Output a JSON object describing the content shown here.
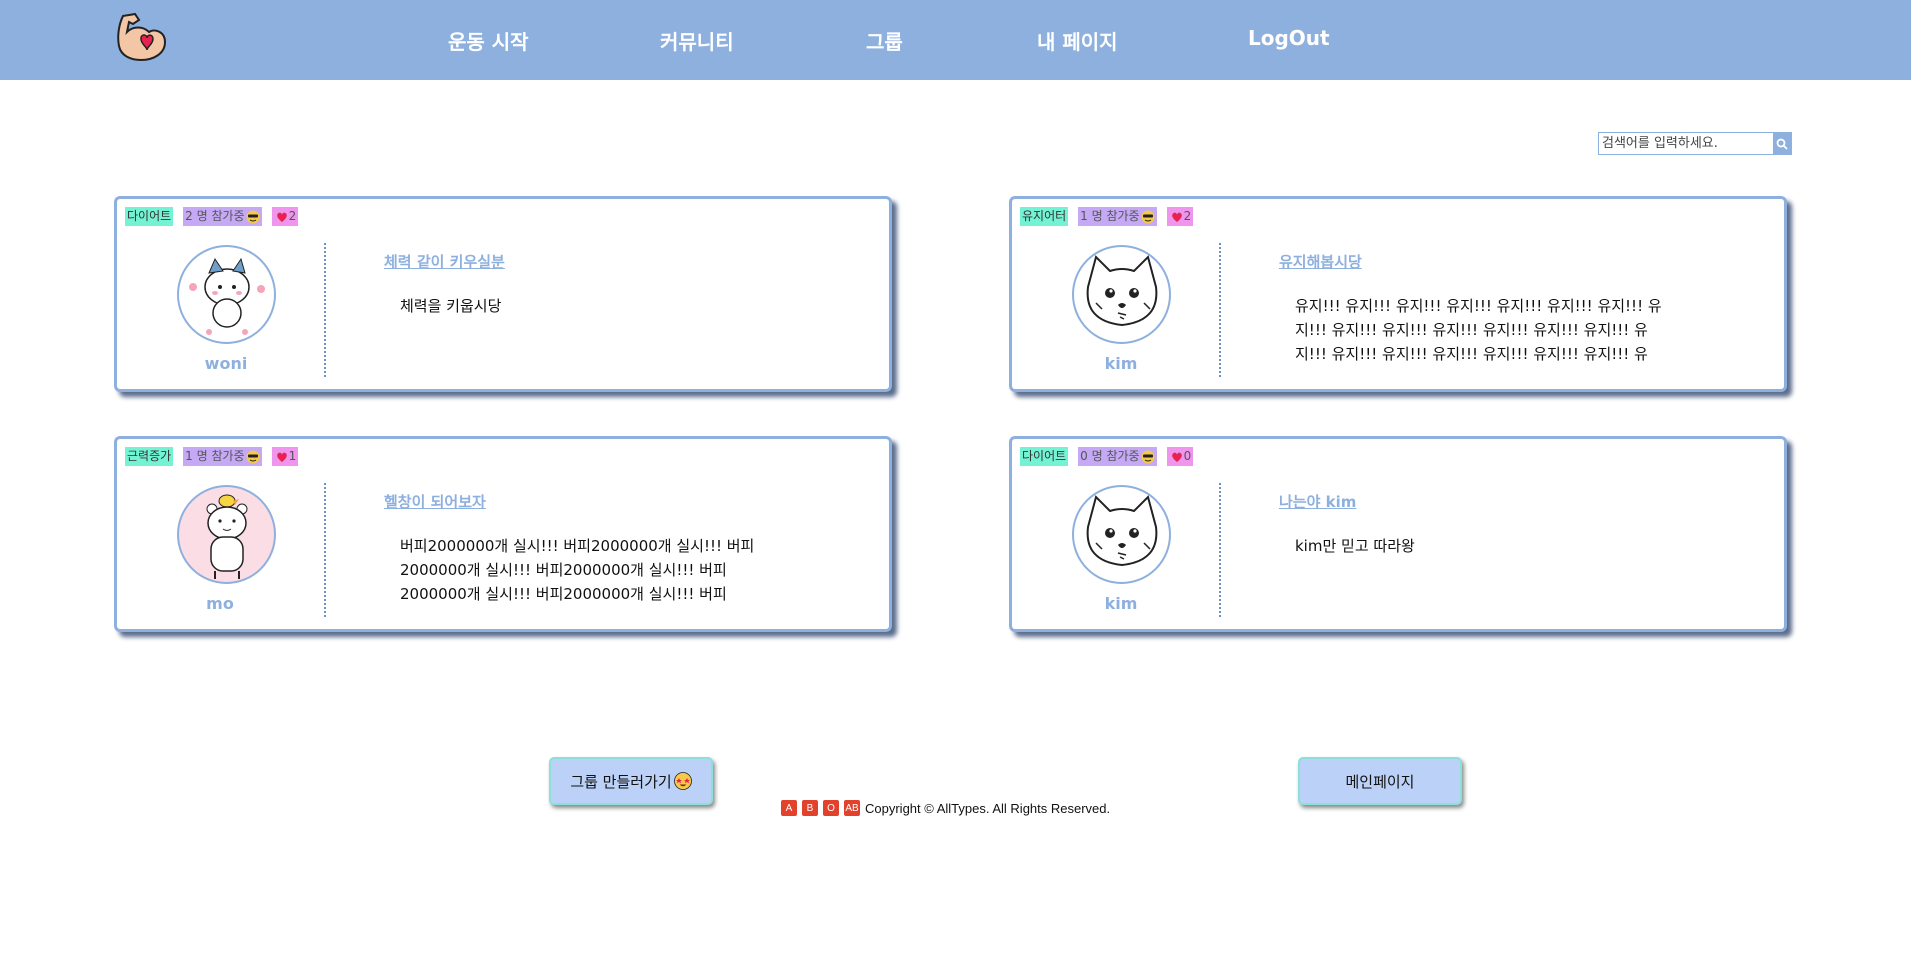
{
  "nav": {
    "items": [
      {
        "label": "운동 시작"
      },
      {
        "label": "커뮤니티"
      },
      {
        "label": "그룹"
      },
      {
        "label": "내 페이지"
      },
      {
        "label": "LogOut"
      }
    ]
  },
  "search": {
    "placeholder": "검색어를 입력하세요.",
    "icon": "search-icon"
  },
  "cards": [
    {
      "category": "다이어트",
      "participants": "2 명 참가중",
      "likes": "2",
      "username": "woni",
      "title": "체력 같이 키우실분",
      "body": "체력을 키웁시당"
    },
    {
      "category": "유지어터",
      "participants": "1 명 참가중",
      "likes": "2",
      "username": "kim",
      "title": "유지해봅시당",
      "body": "유지!!! 유지!!! 유지!!! 유지!!! 유지!!! 유지!!! 유지!!! 유지!!! 유지!!! 유지!!! 유지!!! 유지!!! 유지!!! 유지!!! 유지!!! 유지!!! 유지!!! 유지!!! 유지!!! 유지!!! 유지!!! 유"
    },
    {
      "category": "근력증가",
      "participants": "1 명 참가중",
      "likes": "1",
      "username": "mo",
      "title": "헬창이 되어보자",
      "body": "버피2000000개 실시!!! 버피2000000개 실시!!! 버피2000000개 실시!!! 버피2000000개 실시!!! 버피2000000개 실시!!! 버피2000000개 실시!!! 버피"
    },
    {
      "category": "다이어트",
      "participants": "0 명 참가중",
      "likes": "0",
      "username": "kim",
      "title": "나는야 kim",
      "body": "kim만 믿고 따라왕"
    }
  ],
  "buttons": {
    "create_group": "그룹 만들러가기",
    "main_page": "메인페이지"
  },
  "footer": {
    "badges": [
      "A",
      "B",
      "O",
      "AB"
    ],
    "copyright": "Copyright © AllTypes. All Rights Reserved."
  },
  "colors": {
    "accent": "#8eb0df",
    "tag_category": "#74f2d4",
    "tag_participants": "#c6a9f5",
    "tag_likes": "#ef95ee",
    "button": "#bcd1f7"
  }
}
